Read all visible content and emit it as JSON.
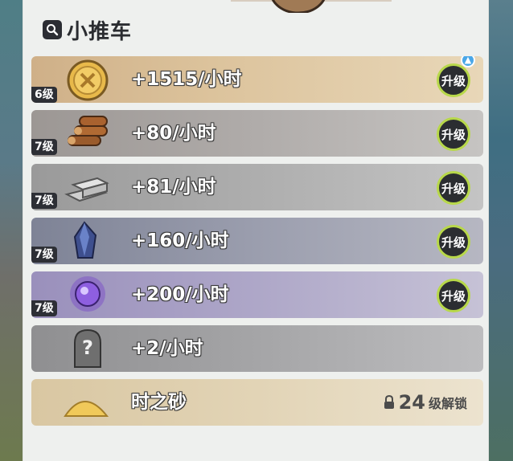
{
  "header": {
    "title": "小推车"
  },
  "rows": [
    {
      "level": "6级",
      "rate": "+1515/小时",
      "action": "升级",
      "has_notice": true,
      "icon": "gold-coin-icon",
      "color": "#d8be96"
    },
    {
      "level": "7级",
      "rate": "+80/小时",
      "action": "升级",
      "has_notice": false,
      "icon": "wood-logs-icon",
      "color": "#a9a6a4"
    },
    {
      "level": "7级",
      "rate": "+81/小时",
      "action": "升级",
      "has_notice": false,
      "icon": "stone-bricks-icon",
      "color": "#a3a3a3"
    },
    {
      "level": "7级",
      "rate": "+160/小时",
      "action": "升级",
      "has_notice": false,
      "icon": "blue-crystal-icon",
      "color": "#8e91a4"
    },
    {
      "level": "7级",
      "rate": "+200/小时",
      "action": "升级",
      "has_notice": false,
      "icon": "purple-orb-icon",
      "color": "#a89fc0"
    },
    {
      "level": "",
      "rate": "+2/小时",
      "action": "",
      "has_notice": false,
      "icon": "mystery-stone-icon",
      "color": "#9e9ea0"
    },
    {
      "level": "",
      "rate": "时之砂",
      "action": "",
      "has_notice": false,
      "icon": "sand-pile-icon",
      "color": "#dccca7",
      "lock_level": "24",
      "lock_text": "级解锁"
    }
  ]
}
